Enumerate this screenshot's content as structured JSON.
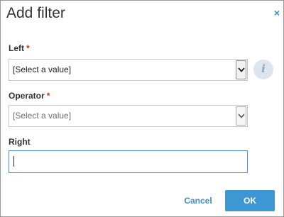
{
  "dialog": {
    "title": "Add filter",
    "close_icon": "close-icon",
    "close_glyph": "×"
  },
  "fields": {
    "left": {
      "label": "Left",
      "required_mark": "*",
      "selected": "[Select a value]",
      "info_icon": "info-icon",
      "info_glyph": "i"
    },
    "operator": {
      "label": "Operator",
      "required_mark": "*",
      "selected": "[Select a value]",
      "disabled": true
    },
    "right": {
      "label": "Right",
      "value": ""
    }
  },
  "buttons": {
    "cancel": "Cancel",
    "ok": "OK"
  },
  "colors": {
    "accent": "#3d97d3",
    "link": "#3b8fc9",
    "required": "#d9261c",
    "focus_border": "#4e94cf"
  }
}
